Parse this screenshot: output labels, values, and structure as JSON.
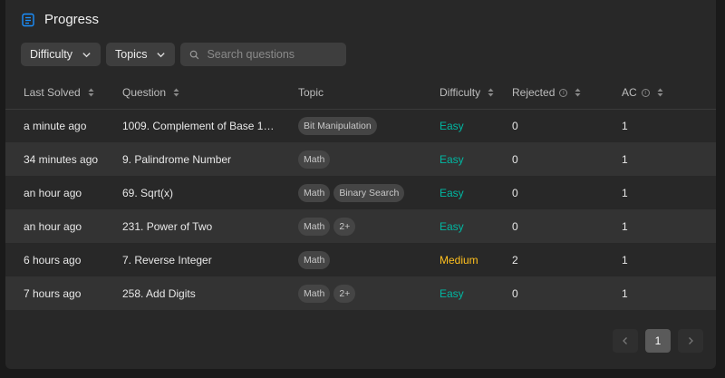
{
  "header": {
    "title": "Progress"
  },
  "filters": {
    "difficulty_label": "Difficulty",
    "topics_label": "Topics",
    "search_placeholder": "Search questions"
  },
  "table": {
    "columns": [
      "Last Solved",
      "Question",
      "Topic",
      "Difficulty",
      "Rejected",
      "AC"
    ],
    "rows": [
      {
        "last_solved": "a minute ago",
        "question": "1009. Complement of Base 10 I...",
        "tags": [
          "Bit Manipulation"
        ],
        "difficulty": "Easy",
        "rejected": "0",
        "ac": "1"
      },
      {
        "last_solved": "34 minutes ago",
        "question": "9. Palindrome Number",
        "tags": [
          "Math"
        ],
        "difficulty": "Easy",
        "rejected": "0",
        "ac": "1"
      },
      {
        "last_solved": "an hour ago",
        "question": "69. Sqrt(x)",
        "tags": [
          "Math",
          "Binary Search"
        ],
        "difficulty": "Easy",
        "rejected": "0",
        "ac": "1"
      },
      {
        "last_solved": "an hour ago",
        "question": "231. Power of Two",
        "tags": [
          "Math",
          "2+"
        ],
        "difficulty": "Easy",
        "rejected": "0",
        "ac": "1"
      },
      {
        "last_solved": "6 hours ago",
        "question": "7. Reverse Integer",
        "tags": [
          "Math"
        ],
        "difficulty": "Medium",
        "rejected": "2",
        "ac": "1"
      },
      {
        "last_solved": "7 hours ago",
        "question": "258. Add Digits",
        "tags": [
          "Math",
          "2+"
        ],
        "difficulty": "Easy",
        "rejected": "0",
        "ac": "1"
      }
    ]
  },
  "pagination": {
    "current_page": "1"
  },
  "colors": {
    "easy": "#00b8a3",
    "medium": "#ffc01e",
    "accent_icon": "#1a90ff"
  },
  "icons": {
    "header": "progress-list-icon",
    "sort": "sort-arrows-icon",
    "info": "info-icon",
    "search": "search-icon",
    "chevron": "chevron-down-icon",
    "prev": "chevron-left-icon",
    "next": "chevron-right-icon"
  }
}
